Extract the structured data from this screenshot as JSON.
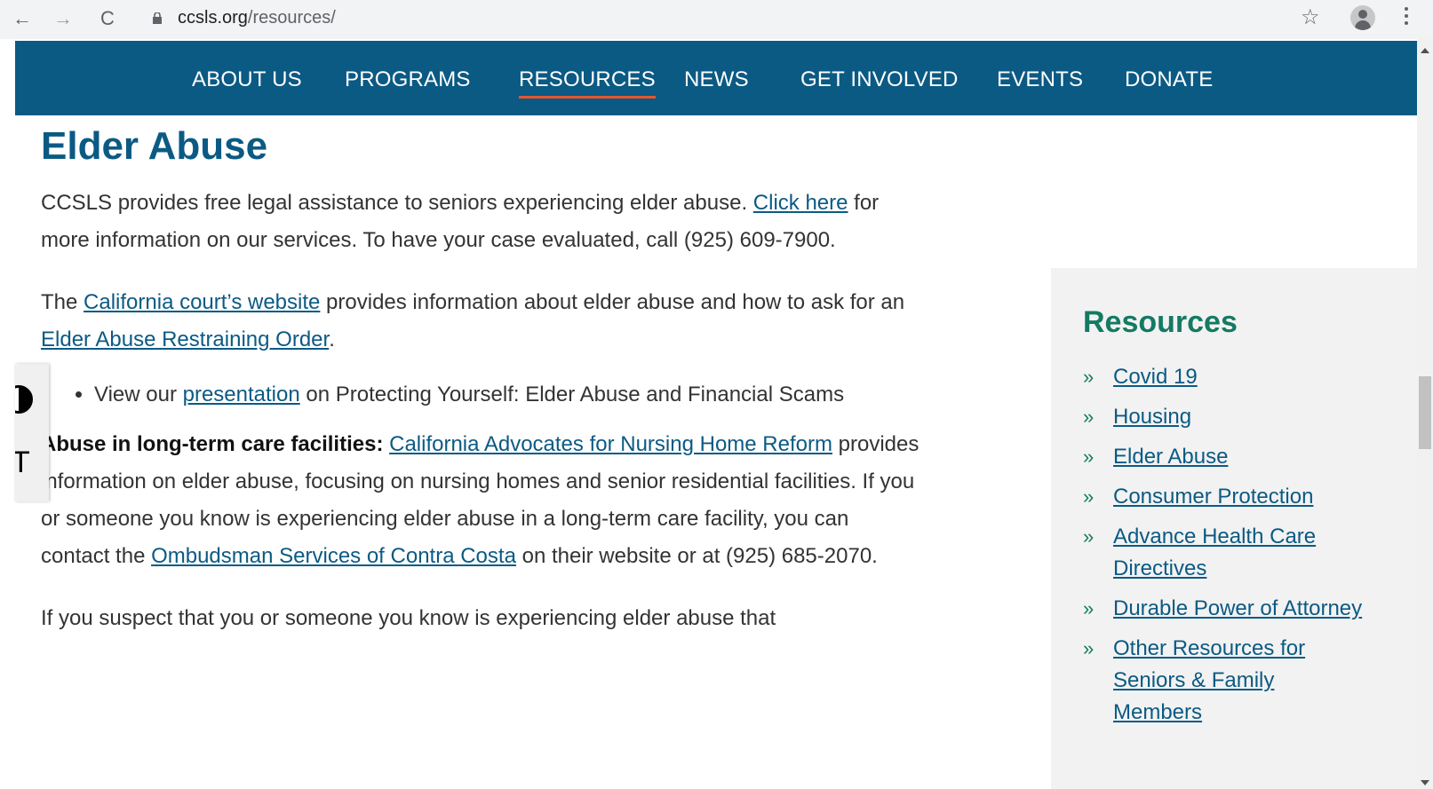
{
  "browser": {
    "url_domain": "ccsls.org",
    "url_path": "/resources/",
    "back_icon": "←",
    "forward_icon": "→",
    "reload_icon": "C",
    "star_icon": "☆"
  },
  "nav": {
    "items": [
      {
        "label": "ABOUT US"
      },
      {
        "label": "PROGRAMS"
      },
      {
        "label": "RESOURCES",
        "active": true
      },
      {
        "label": "NEWS"
      },
      {
        "label": "GET INVOLVED"
      },
      {
        "label": "EVENTS"
      },
      {
        "label": "DONATE"
      }
    ]
  },
  "main": {
    "title": "Elder Abuse",
    "p1": {
      "text1": "CCSLS provides free legal assistance to seniors experiencing elder abuse.  ",
      "link1": "Click here",
      "text2": " for more information on our services.  To have your case evaluated, call (925) 609-7900."
    },
    "p2": {
      "text1": "The ",
      "link1": "California court’s website",
      "text2": " provides information about elder abuse and how to ask for an ",
      "link2": "Elder Abuse Restraining Order",
      "text3": "."
    },
    "bullet": {
      "text1": "View our ",
      "link1": "presentation",
      "text2": " on Protecting Yourself: Elder Abuse and Financial Scams"
    },
    "p3": {
      "bold": "Abuse in long-term care facilities:",
      "text0": " ",
      "link1": "California Advocates for Nursing Home Reform",
      "text1": " provides information on elder abuse, focusing on nursing homes and senior residential facilities.  If you or someone you know is experiencing elder abuse in a long-term care facility, you can contact the ",
      "link2": "Ombudsman Services of Contra Costa",
      "text2": " on their website or at (925) 685-2070."
    },
    "p4": {
      "text1": "If you suspect that you or someone you know is experiencing elder abuse that"
    }
  },
  "sidebar": {
    "title": "Resources",
    "chevron": "»",
    "items": [
      {
        "label": "Covid 19"
      },
      {
        "label": "Housing"
      },
      {
        "label": "Elder Abuse"
      },
      {
        "label": "Consumer Protection"
      },
      {
        "label": "Advance Health Care Directives"
      },
      {
        "label": "Durable Power of Attorney"
      },
      {
        "label": "Other Resources for Seniors & Family Members"
      }
    ]
  },
  "accessibility": {
    "text_size_icon": "T"
  },
  "colors": {
    "nav_bg": "#0b5a84",
    "active_underline": "#e8552d",
    "heading": "#0b5a84",
    "link": "#0b5a84",
    "sidebar_heading": "#147a63",
    "sidebar_bg": "#f2f2f2"
  }
}
